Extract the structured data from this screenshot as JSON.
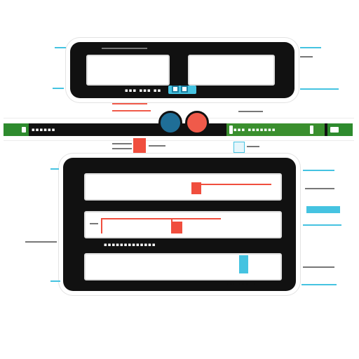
{
  "colors": {
    "panel": "#111111",
    "accent_blue": "#1f6e97",
    "accent_red": "#f05a4a",
    "accent_green": "#2e8b2e",
    "accent_cyan": "#45c3e1"
  },
  "icons": {
    "left_end": "rounded-square-icon",
    "right_end": "rounded-square-icon",
    "cyan_chip": "square-icon"
  }
}
